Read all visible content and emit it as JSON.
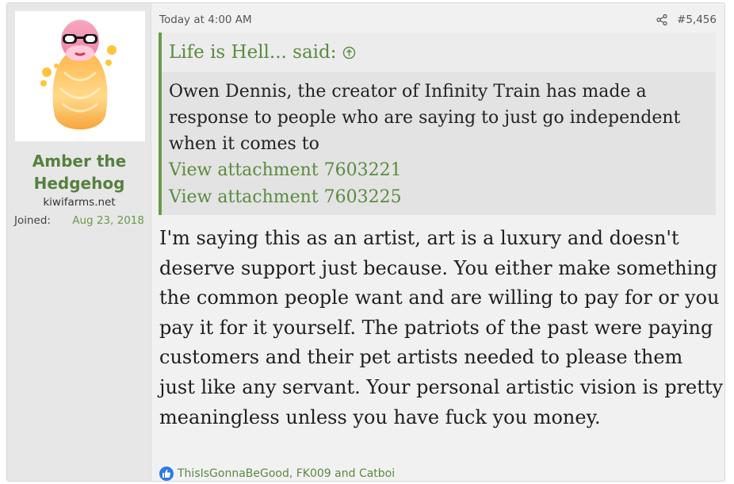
{
  "user": {
    "name": "Amber the Hedgehog",
    "site": "kiwifarms.net",
    "joined_label": "Joined:",
    "joined_date": "Aug 23, 2018"
  },
  "post": {
    "timestamp": "Today at 4:00 AM",
    "number": "#5,456"
  },
  "quote": {
    "author_said": "Life is Hell... said:",
    "text": "Owen Dennis, the creator of Infinity Train has made a response to people who are saying to just go independent when it comes to",
    "attachments": [
      "View attachment 7603221",
      "View attachment 7603225"
    ]
  },
  "message": "I'm saying this as an artist, art is a luxury and doesn't deserve support just because. You either make something the common people want and are willing to pay for or you pay it for it yourself. The patriots of the past were paying customers and their pet artists needed to please them just like any servant. Your personal artistic vision is pretty meaningless unless you have fuck you money.",
  "reactions": {
    "text": "ThisIsGonnaBeGood, FK009 and Catboi"
  },
  "colors": {
    "accent": "#56803e",
    "link": "#5b8a3f",
    "like": "#2c7be5"
  }
}
